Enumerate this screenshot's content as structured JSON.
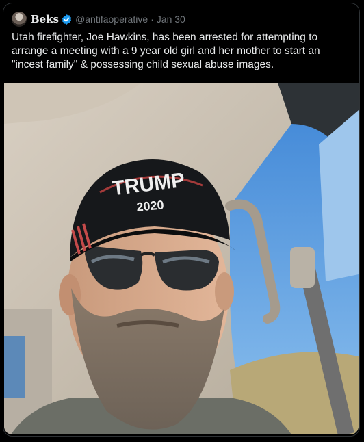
{
  "tweet": {
    "display_name": "Beks",
    "verified_icon": "verified-badge-icon",
    "handle": "@antifaoperative",
    "separator": "·",
    "date": "Jan 30",
    "text": "Utah firefighter, Joe Hawkins, has been arrested for attempting to arrange a meeting with a 9 year old girl and her mother to start an \"incest family\" & possessing child sexual abuse images."
  },
  "media": {
    "cap_text_line1": "TRUMP",
    "cap_text_line2": "2020"
  },
  "colors": {
    "background": "#000000",
    "text": "#e7e9ea",
    "muted": "#71767b",
    "verified": "#1d9bf0"
  }
}
